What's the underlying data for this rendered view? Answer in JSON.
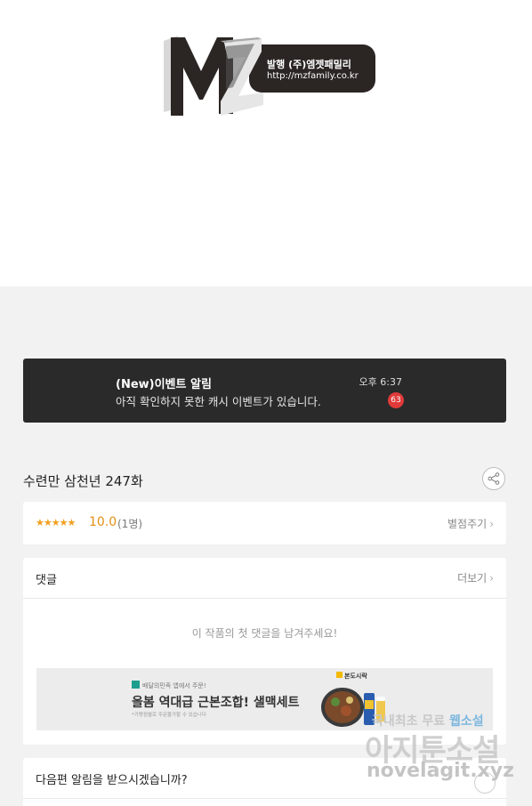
{
  "logo": {
    "letters": "MZ",
    "publisher": "발행 (주)엠젯패밀리",
    "url": "http://mzfamily.co.kr"
  },
  "notification": {
    "title": "(New)이벤트 알림",
    "body": "아직 확인하지 못한 캐시 이벤트가 있습니다.",
    "time": "오후 6:37",
    "badge_count": "63"
  },
  "episode": {
    "title": "수련만 삼천년 247화",
    "share_icon": "share-icon"
  },
  "rating": {
    "stars": "★★★★★",
    "score": "10.0",
    "count": "(1명)",
    "rate_label": "별점주기",
    "chevron": "›"
  },
  "comments": {
    "header": "댓글",
    "more_label": "더보기",
    "chevron": "›",
    "empty_text": "이 작품의 첫 댓글을 남겨주세요!"
  },
  "ad": {
    "brand": "배달의민족 앱에서 주문!",
    "store": "본도시락",
    "headline": "올봄 역대급 근본조합! 샐맥세트",
    "fine_print": "*가맹점별로 주문불가할 수 있습니다"
  },
  "next_episode": {
    "question": "다음편 알림을 받으시겠습니까?"
  },
  "watermark": {
    "line1_prefix": "국내최초 무료 ",
    "line1_accent": "웹소설",
    "line2": "아지툰소설",
    "line3": "novelagit.xyz"
  },
  "colors": {
    "notification_bg": "#2a2a2a",
    "badge": "#e03a3a",
    "rating_accent": "#e58f12",
    "page_bg": "#f2f2f3"
  }
}
